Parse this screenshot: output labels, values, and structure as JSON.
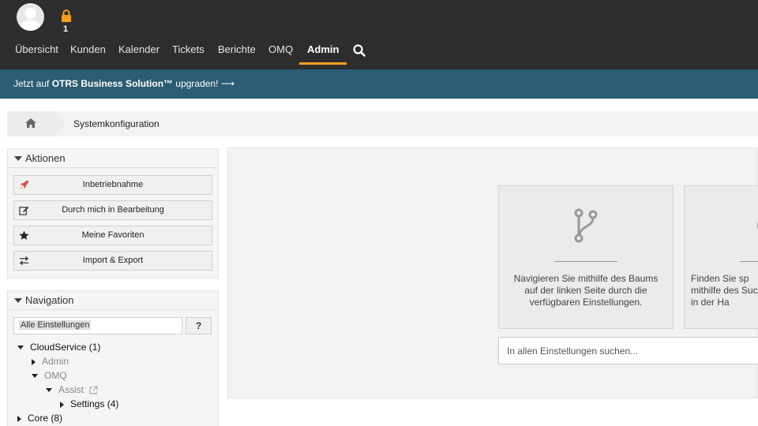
{
  "header": {
    "lock_count": "1",
    "nav": [
      {
        "label": "Übersicht"
      },
      {
        "label": "Kunden"
      },
      {
        "label": "Kalender"
      },
      {
        "label": "Tickets"
      },
      {
        "label": "Berichte"
      },
      {
        "label": "OMQ"
      },
      {
        "label": "Admin",
        "active": true
      }
    ],
    "accent_color": "#f4a11a"
  },
  "banner": {
    "prefix": "Jetzt auf ",
    "product": "OTRS Business Solution™",
    "suffix": " upgraden! ⟶",
    "background": "#2a5d73"
  },
  "breadcrumb": {
    "current": "Systemkonfiguration"
  },
  "actions": {
    "title": "Aktionen",
    "buttons": [
      {
        "label": "Inbetriebnahme",
        "icon": "rocket-icon"
      },
      {
        "label": "Durch mich in Bearbeitung",
        "icon": "edit-icon"
      },
      {
        "label": "Meine Favoriten",
        "icon": "star-icon"
      },
      {
        "label": "Import & Export",
        "icon": "exchange-icon"
      }
    ]
  },
  "navigation": {
    "title": "Navigation",
    "filter_value": "Alle Einstellungen",
    "help_label": "?",
    "tree": [
      {
        "label": "CloudService",
        "count": "(1)"
      },
      {
        "label": "Admin"
      },
      {
        "label": "OMQ"
      },
      {
        "label": "Assist"
      },
      {
        "label": "Settings",
        "count": "(4)"
      },
      {
        "label": "Core",
        "count": "(8)"
      }
    ]
  },
  "main": {
    "card1_text": "Navigieren Sie mithilfe des Baums auf der linken Seite durch die verfügbaren Einstellungen.",
    "card2_text": "Finden Sie sp mithilfe des Suc in der Ha",
    "search_placeholder": "In allen Einstellungen suchen..."
  }
}
